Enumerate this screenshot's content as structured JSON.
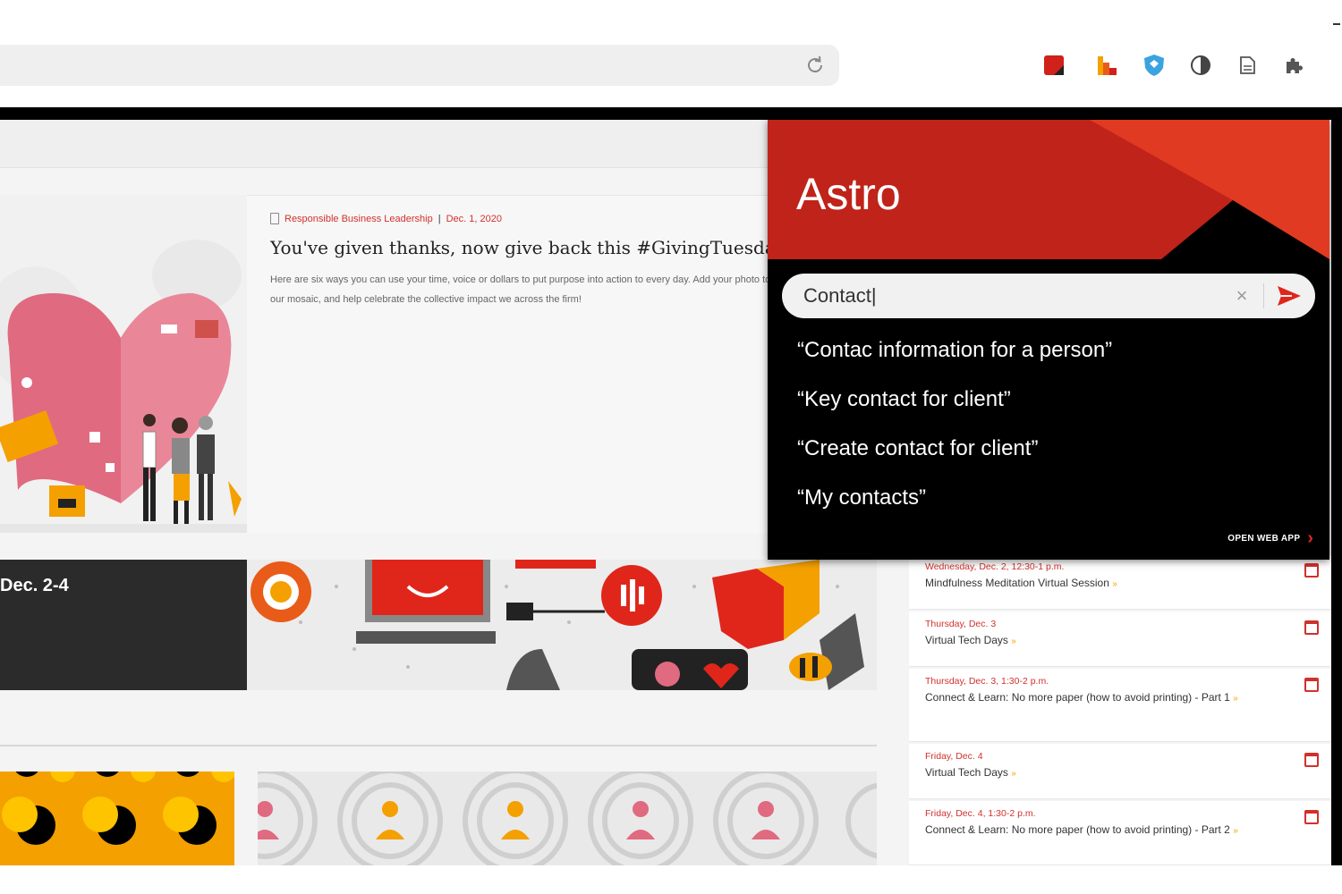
{
  "browser": {
    "extensions": [
      "red-square-extension-icon",
      "orange-bars-extension-icon",
      "blue-shield-extension-icon",
      "moon-extension-icon",
      "document-extension-icon",
      "puzzle-extension-icon"
    ]
  },
  "feature": {
    "category": "Responsible Business Leadership",
    "separator": "|",
    "date": "Dec. 1, 2020",
    "headline": "You've given thanks, now give back this #GivingTuesday",
    "headline_chevron": "»",
    "summary": "Here are six ways you can use your time, voice or dollars to put purpose into action to every day. Add your photo to our mosaic, and help celebrate the collective impact we across the firm!"
  },
  "banner": {
    "date_range": "Dec. 2-4"
  },
  "events": [
    {
      "date": "Wednesday, Dec. 2, 12:30-1 p.m.",
      "title": "Mindfulness Meditation Virtual Session",
      "arrow": "»"
    },
    {
      "date": "Thursday, Dec. 3",
      "title": "Virtual Tech Days",
      "arrow": "»"
    },
    {
      "date": "Thursday, Dec. 3, 1:30-2 p.m.",
      "title": "Connect & Learn: No more paper (how to avoid printing) - Part 1",
      "arrow": "»"
    },
    {
      "date": "Friday, Dec. 4",
      "title": "Virtual Tech Days",
      "arrow": "»"
    },
    {
      "date": "Friday, Dec. 4, 1:30-2 p.m.",
      "title": "Connect & Learn: No more paper (how to avoid printing) - Part 2",
      "arrow": "»"
    }
  ],
  "astro": {
    "title": "Astro",
    "search_value": "Contact|",
    "clear_symbol": "×",
    "suggestions": [
      "“Contac information for a person”",
      "“Key contact for client”",
      "“Create contact for client”",
      "“My contacts”"
    ],
    "open_web_app": "OPEN WEB APP",
    "open_web_chevron": "›",
    "colors": {
      "header_red": "#c0231a",
      "accent_red": "#e0261b",
      "panel_black": "#000000"
    }
  },
  "colors": {
    "brand_red": "#d0312d",
    "accent_orange": "#f4a000",
    "page_bg": "#f4f4f4"
  }
}
